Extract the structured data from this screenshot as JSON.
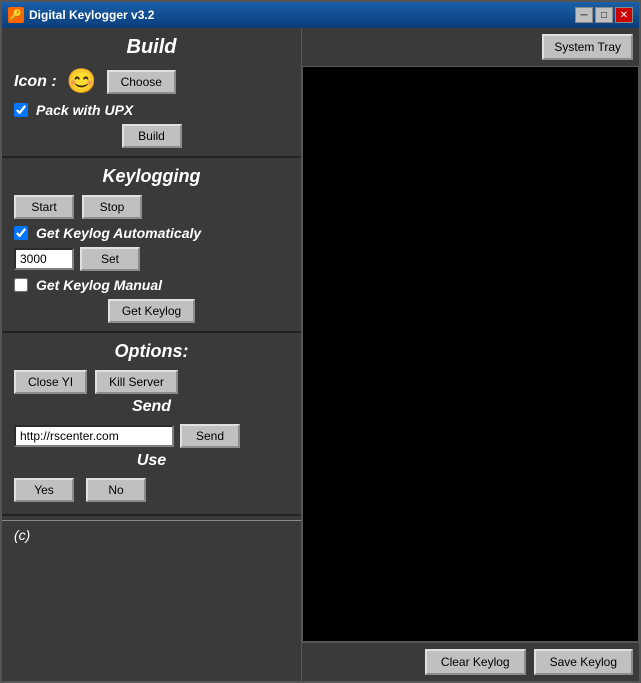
{
  "window": {
    "title": "Digital Keylogger v3.2",
    "title_icon": "🔑"
  },
  "title_buttons": {
    "minimize": "─",
    "maximize": "□",
    "close": "✕"
  },
  "system_tray": {
    "label": "System Tray"
  },
  "build_section": {
    "title": "Build",
    "icon_label": "Icon :",
    "icon_emoji": "😊",
    "choose_label": "Choose",
    "pack_upx_label": "Pack with UPX",
    "pack_upx_checked": true,
    "build_label": "Build"
  },
  "keylogging_section": {
    "title": "Keylogging",
    "start_label": "Start",
    "stop_label": "Stop",
    "auto_label": "Get Keylog Automaticaly",
    "auto_checked": true,
    "interval_value": "3000",
    "set_label": "Set",
    "manual_label": "Get Keylog Manual",
    "manual_checked": false,
    "get_keylog_label": "Get Keylog"
  },
  "options_section": {
    "title": "Options:",
    "close_yi_label": "Close YI",
    "kill_server_label": "Kill Server",
    "send_title": "Send",
    "url_value": "http://rscenter.com",
    "url_placeholder": "http://rscenter.com",
    "send_label": "Send",
    "use_title": "Use",
    "yes_label": "Yes",
    "no_label": "No"
  },
  "footer": {
    "copyright": "(c)"
  },
  "bottom_bar": {
    "clear_keylog": "Clear Keylog",
    "save_keylog": "Save Keylog"
  }
}
